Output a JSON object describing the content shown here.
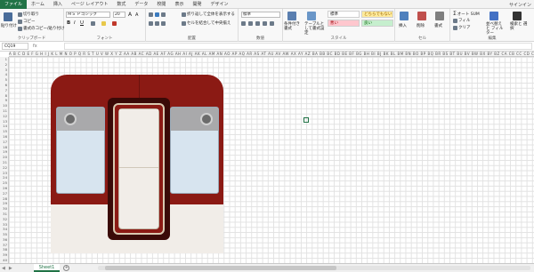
{
  "menu": {
    "file": "ファイル",
    "tabs": [
      "ホーム",
      "挿入",
      "ページ レイアウト",
      "数式",
      "データ",
      "校閲",
      "表示",
      "開発",
      "デザイン"
    ],
    "user": "サインイン"
  },
  "ribbon": {
    "clipboard": {
      "label": "クリップボード",
      "paste": "貼り付け",
      "cut": "切り取り",
      "copy": "コピー",
      "format_painter": "書式のコピー/貼り付け"
    },
    "font": {
      "label": "フォント",
      "font_name": "ＭＳ Ｐゴシック",
      "font_size": "20",
      "grow": "A",
      "shrink": "A",
      "bold": "B",
      "italic": "I",
      "underline": "U"
    },
    "alignment": {
      "label": "配置",
      "wrap_text": "折り返して全体を表示する",
      "merge_center": "セルを結合して中央揃え"
    },
    "number": {
      "label": "数値",
      "format": "標準"
    },
    "styles": {
      "label": "スタイル",
      "conditional": "条件付き書式",
      "table": "テーブルとして書式設定",
      "normal": "標準",
      "neutral": "どちらでもない",
      "bad": "悪い",
      "good": "良い"
    },
    "cells": {
      "label": "セル",
      "insert": "挿入",
      "delete": "削除",
      "format": "書式"
    },
    "editing": {
      "label": "編集",
      "autosum": "オート SUM",
      "fill": "フィル",
      "clear": "クリア",
      "sort_filter": "並べ替えと フィルター",
      "find_select": "検索と 選択"
    }
  },
  "formula_bar": {
    "name_box": "CQ19",
    "fx": "fx",
    "value": ""
  },
  "grid": {
    "column_header_text": "A B C D E F G H I J K L M N O P Q R S T U V W X Y Z AA AB AC AD AE AF AG AH AI AJ AK AL AM AN AO AP AQ AR AS AT AU AV AW AX AY AZ BA BB BC BD BE BF BG BH BI BJ BK BL BM BN BO BP BQ BR BS BT BU BV BW BX BY BZ CA CB CC CD CE CF CG CH CI CJ CK CL CM CN CO CP CQ CR CS CT CU CV CW CX CY CZ DA DB DC DD DE DF DG DH DI DJ DK DL DM DN DO DP DQ DR DS DT DU DV DW DX DY DZ EA EB EC ED EE EF EG EH",
    "rows": [
      "1",
      "2",
      "3",
      "4",
      "5",
      "6",
      "7",
      "8",
      "9",
      "10",
      "11",
      "12",
      "13",
      "14",
      "15",
      "16",
      "17",
      "18",
      "19",
      "20",
      "21",
      "22",
      "23",
      "24",
      "25",
      "26",
      "27",
      "28",
      "29",
      "30",
      "31",
      "32",
      "33",
      "34",
      "35",
      "36",
      "37",
      "38",
      "39",
      "40"
    ]
  },
  "colors": {
    "excel_green": "#217346",
    "train_red": "#8b1a14",
    "train_cream": "#f1ede8",
    "window_blue": "#d7e4ef"
  },
  "sheets": {
    "tabs": [
      "Sheet1"
    ],
    "add": "+"
  }
}
